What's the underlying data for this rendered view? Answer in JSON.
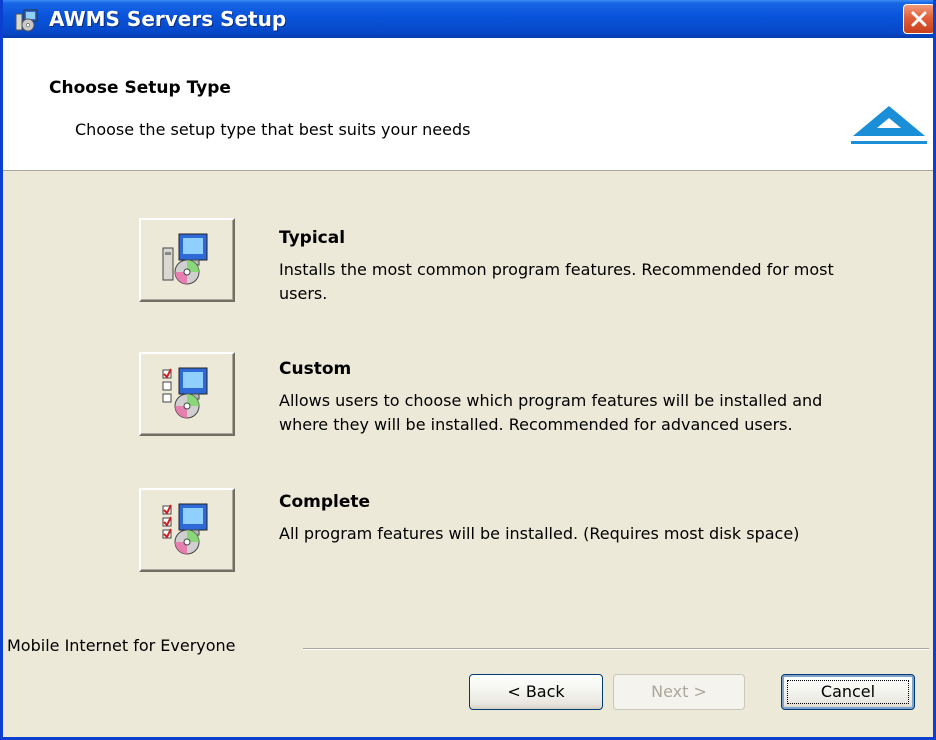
{
  "window": {
    "title": "AWMS Servers Setup"
  },
  "header": {
    "title": "Choose Setup Type",
    "subtitle": "Choose the setup type that best suits your needs"
  },
  "options": [
    {
      "title": "Typical",
      "description": "Installs the most common program features. Recommended for most users."
    },
    {
      "title": "Custom",
      "description": "Allows users to choose which program features will be installed and where they will be installed. Recommended for advanced users."
    },
    {
      "title": "Complete",
      "description": "All program features will be installed.  (Requires most disk space)"
    }
  ],
  "footer": {
    "branding": "Mobile Internet for Everyone",
    "back_label": "< Back",
    "next_label": "Next >",
    "cancel_label": "Cancel"
  },
  "colors": {
    "titlebar": "#0a55dc",
    "close_button": "#e0603a",
    "dialog_background": "#ece9d8",
    "logo": "#1a8fd8"
  },
  "icons": {
    "title_icon": "installer-icon",
    "close": "close-icon",
    "logo": "awms-logo",
    "typical": "typical-setup-icon",
    "custom": "custom-setup-icon",
    "complete": "complete-setup-icon"
  }
}
